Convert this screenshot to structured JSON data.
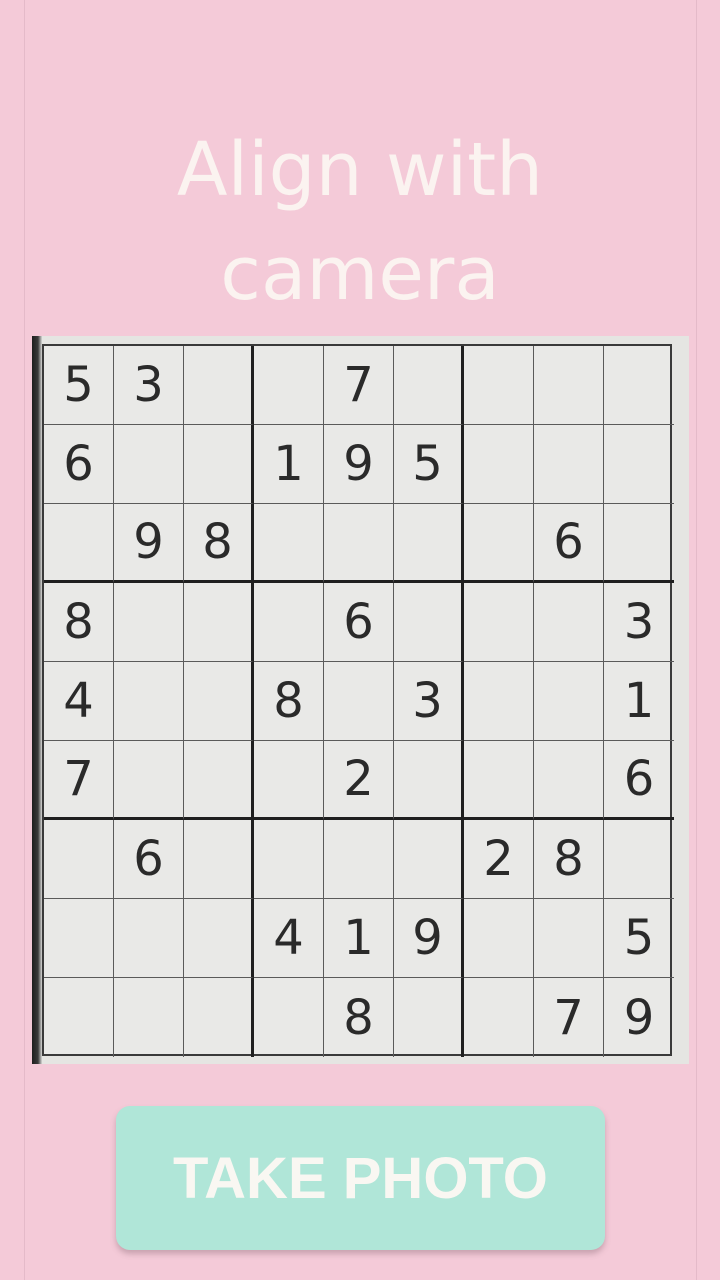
{
  "instruction": {
    "line1": "Align with",
    "line2": "camera"
  },
  "sudoku": {
    "rows": [
      [
        "5",
        "3",
        "",
        "",
        "7",
        "",
        "",
        "",
        ""
      ],
      [
        "6",
        "",
        "",
        "1",
        "9",
        "5",
        "",
        "",
        ""
      ],
      [
        "",
        "9",
        "8",
        "",
        "",
        "",
        "",
        "6",
        ""
      ],
      [
        "8",
        "",
        "",
        "",
        "6",
        "",
        "",
        "",
        "3"
      ],
      [
        "4",
        "",
        "",
        "8",
        "",
        "3",
        "",
        "",
        "1"
      ],
      [
        "7",
        "",
        "",
        "",
        "2",
        "",
        "",
        "",
        "6"
      ],
      [
        "",
        "6",
        "",
        "",
        "",
        "",
        "2",
        "8",
        ""
      ],
      [
        "",
        "",
        "",
        "4",
        "1",
        "9",
        "",
        "",
        "5"
      ],
      [
        "",
        "",
        "",
        "",
        "8",
        "",
        "",
        "7",
        "9"
      ]
    ]
  },
  "take_photo_button": {
    "label": "TAKE PHOTO"
  },
  "colors": {
    "background": "#f4cad8",
    "button": "#b0e6d8",
    "text_light": "#fbf3f0"
  }
}
